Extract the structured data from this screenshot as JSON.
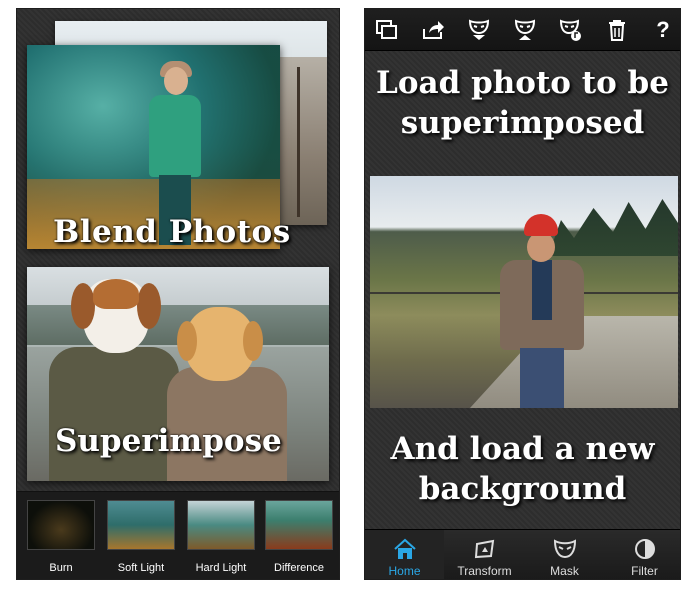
{
  "left_screen": {
    "blend_title": "Blend Photos",
    "superimpose_title": "Superimpose",
    "blend_modes": [
      {
        "label": "Burn"
      },
      {
        "label": "Soft Light"
      },
      {
        "label": "Hard Light"
      },
      {
        "label": "Difference"
      }
    ]
  },
  "right_screen": {
    "toolbar": {
      "icons": [
        "layers-icon",
        "share-icon",
        "mask-down-icon",
        "mask-up-icon",
        "mask-music-icon",
        "trash-icon",
        "help-icon"
      ],
      "help_label": "?"
    },
    "heading_top": "Load photo to be superimposed",
    "heading_bottom": "And load a new background",
    "nav": [
      {
        "label": "Home",
        "icon": "home-icon",
        "active": true
      },
      {
        "label": "Transform",
        "icon": "transform-icon",
        "active": false
      },
      {
        "label": "Mask",
        "icon": "mask-icon",
        "active": false
      },
      {
        "label": "Filter",
        "icon": "filter-icon",
        "active": false
      }
    ],
    "accent_color": "#2aa7e6"
  }
}
